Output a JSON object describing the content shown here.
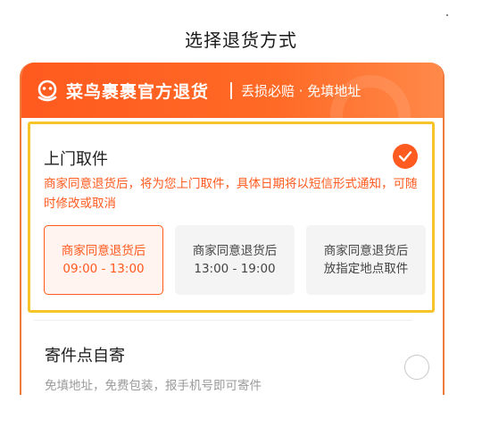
{
  "page": {
    "title": "选择退货方式"
  },
  "card": {
    "brand": "菜鸟裹裹官方退货",
    "subtitle": "丢损必赔 · 免填地址",
    "logo_icon": "cainiao-logo-icon",
    "accent_color": "#ff5a1f",
    "highlight_border_color": "#f7c52a"
  },
  "options": [
    {
      "title": "上门取件",
      "selected": true,
      "description": "商家同意退货后，将为您上门取件，具体日期将以短信形式通知，可随时修改或取消",
      "slots": [
        {
          "line1": "商家同意退货后",
          "line2": "09:00 - 13:00",
          "selected": true
        },
        {
          "line1": "商家同意退货后",
          "line2": "13:00 - 19:00",
          "selected": false
        },
        {
          "line1": "商家同意退货后",
          "line2": "放指定地点取件",
          "selected": false
        }
      ]
    },
    {
      "title": "寄件点自寄",
      "selected": false,
      "description": "免填地址，免费包装，报手机号即可寄件"
    }
  ]
}
